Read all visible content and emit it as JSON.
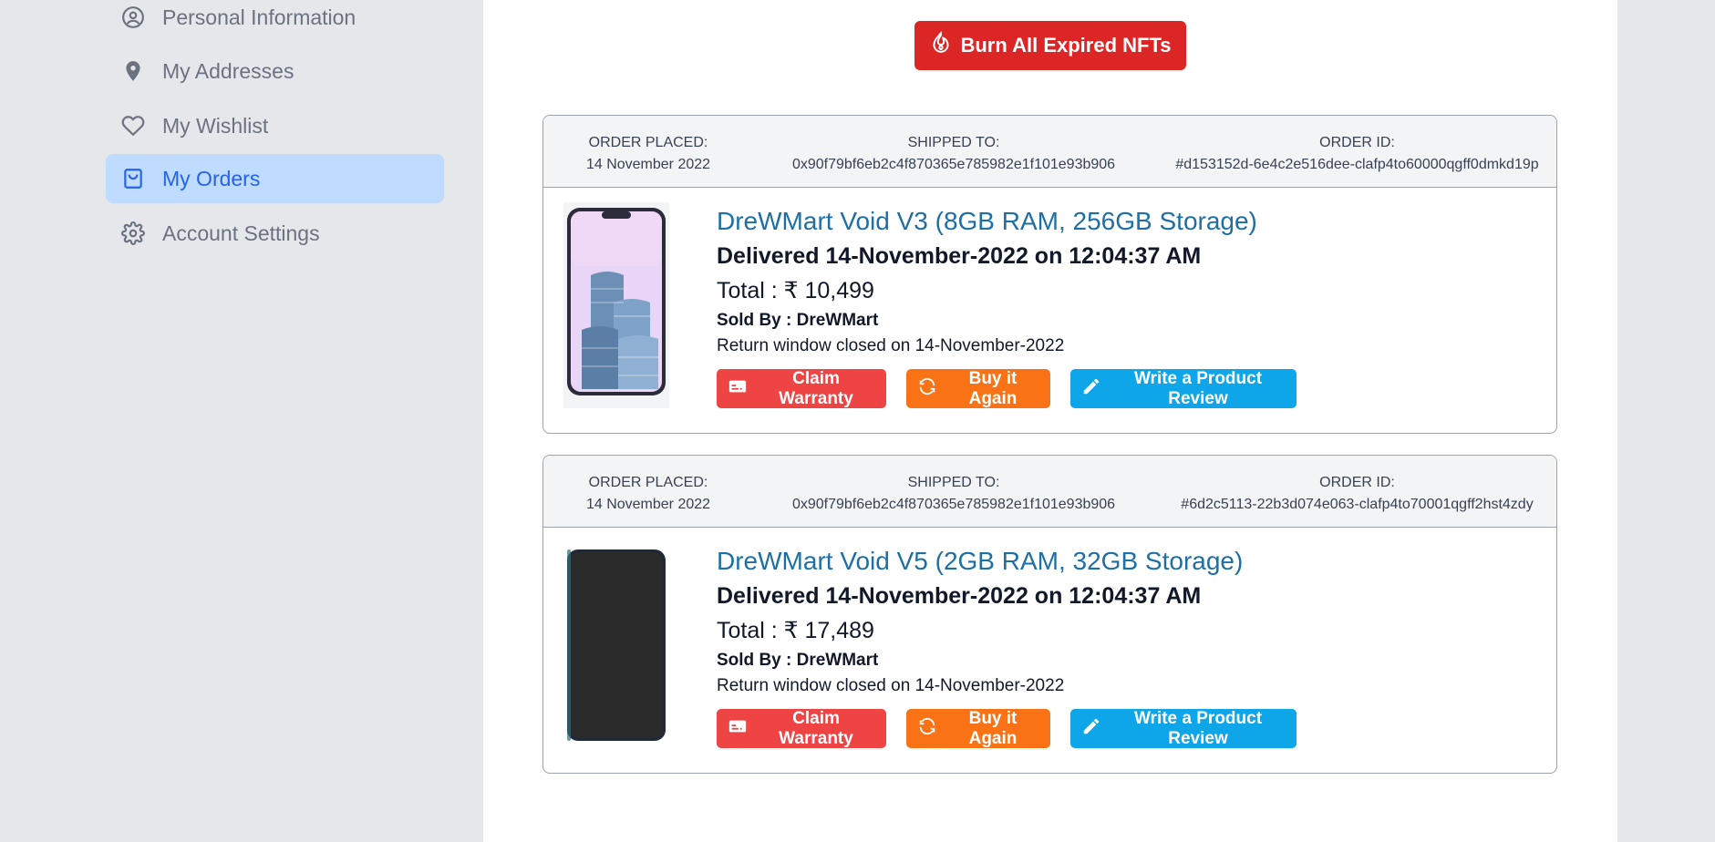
{
  "sidebar": {
    "items": [
      {
        "label": "Personal Information",
        "icon": "user-circle-icon"
      },
      {
        "label": "My Addresses",
        "icon": "map-pin-icon"
      },
      {
        "label": "My Wishlist",
        "icon": "heart-icon"
      },
      {
        "label": "My Orders",
        "icon": "shopping-bag-icon",
        "active": true
      },
      {
        "label": "Account Settings",
        "icon": "gear-icon"
      }
    ]
  },
  "main": {
    "burn_button_label": "Burn All Expired NFTs",
    "head_labels": {
      "placed": "ORDER PLACED:",
      "shipped": "SHIPPED TO:",
      "order_id": "ORDER ID:"
    },
    "button_labels": {
      "warranty": "Claim Warranty",
      "again": "Buy it Again",
      "review": "Write a Product Review"
    },
    "orders": [
      {
        "placed": "14 November 2022",
        "shipped_to": "0x90f79bf6eb2c4f870365e785982e1f101e93b906",
        "order_id": "#d153152d-6e4c2e516dee-clafp4to60000qgff0dmkd19p",
        "title": "DreWMart Void V3 (8GB RAM, 256GB Storage)",
        "delivered": "Delivered 14-November-2022 on 12:04:37 AM",
        "total": "Total : ₹ 10,499",
        "sold_by": "Sold By : DreWMart",
        "return_window": "Return window closed on 14-November-2022"
      },
      {
        "placed": "14 November 2022",
        "shipped_to": "0x90f79bf6eb2c4f870365e785982e1f101e93b906",
        "order_id": "#6d2c5113-22b3d074e063-clafp4to70001qgff2hst4zdy",
        "title": "DreWMart Void V5 (2GB RAM, 32GB Storage)",
        "delivered": "Delivered 14-November-2022 on 12:04:37 AM",
        "total": "Total : ₹ 17,489",
        "sold_by": "Sold By : DreWMart",
        "return_window": "Return window closed on 14-November-2022"
      }
    ]
  },
  "colors": {
    "accent_blue": "#2563eb",
    "burn_red": "#dc2626",
    "warranty_red": "#ef4444",
    "again_orange": "#f97316",
    "review_blue": "#0ea5e9",
    "title_blue": "#1d6fa5"
  }
}
